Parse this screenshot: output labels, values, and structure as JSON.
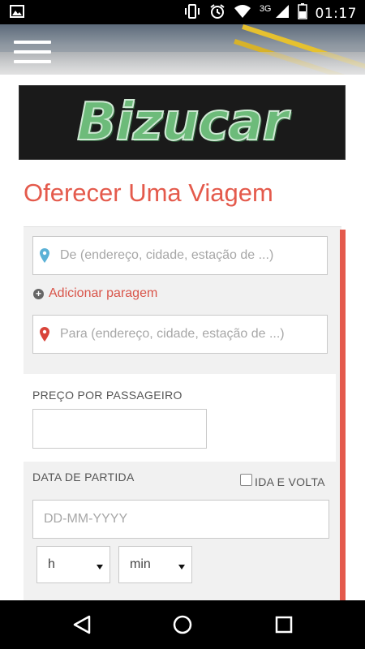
{
  "status_bar": {
    "time": "01:17",
    "network_type": "3G",
    "icons": [
      "image-icon",
      "vibrate-icon",
      "alarm-icon",
      "wifi-icon",
      "signal-icon",
      "battery-icon"
    ]
  },
  "header": {
    "menu_icon": "hamburger-menu-icon",
    "logo_text": "Bizucar"
  },
  "page": {
    "title": "Oferecer Uma Viagem"
  },
  "form": {
    "from_placeholder": "De (endereço, cidade, estação de ...)",
    "add_stop_label": "Adicionar paragem",
    "to_placeholder": "Para (endereço, cidade, estação de ...)",
    "price_label": "PREÇO POR PASSAGEIRO",
    "price_value": "",
    "departure_label": "DATA DE PARTIDA",
    "round_trip_label": "IDA E VOLTA",
    "date_placeholder": "DD-MM-YYYY",
    "hour_value": "h",
    "minute_value": "min"
  },
  "nav_bar": {
    "icons": [
      "back-icon",
      "home-icon",
      "recents-icon"
    ]
  },
  "colors": {
    "accent": "#e45a4c",
    "logo_green": "#6dbb7a",
    "pin_from": "#5bb1d6",
    "pin_to": "#d9443a"
  }
}
